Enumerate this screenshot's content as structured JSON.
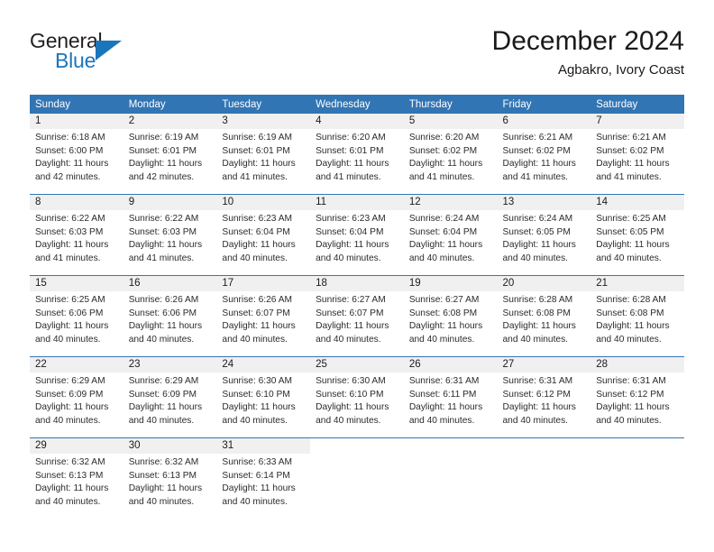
{
  "logo": {
    "word_one": "General",
    "word_two": "Blue",
    "triangle": "triangle-icon"
  },
  "header": {
    "title": "December 2024",
    "subtitle": "Agbakro, Ivory Coast"
  },
  "calendar": {
    "weekday_headers": [
      "Sunday",
      "Monday",
      "Tuesday",
      "Wednesday",
      "Thursday",
      "Friday",
      "Saturday"
    ],
    "accent_color": "#3275b4",
    "daynum_band_color": "#f0f0f0",
    "weeks": [
      [
        {
          "day": "1",
          "sunrise": "Sunrise: 6:18 AM",
          "sunset": "Sunset: 6:00 PM",
          "daylight_line1": "Daylight: 11 hours",
          "daylight_line2": "and 42 minutes."
        },
        {
          "day": "2",
          "sunrise": "Sunrise: 6:19 AM",
          "sunset": "Sunset: 6:01 PM",
          "daylight_line1": "Daylight: 11 hours",
          "daylight_line2": "and 42 minutes."
        },
        {
          "day": "3",
          "sunrise": "Sunrise: 6:19 AM",
          "sunset": "Sunset: 6:01 PM",
          "daylight_line1": "Daylight: 11 hours",
          "daylight_line2": "and 41 minutes."
        },
        {
          "day": "4",
          "sunrise": "Sunrise: 6:20 AM",
          "sunset": "Sunset: 6:01 PM",
          "daylight_line1": "Daylight: 11 hours",
          "daylight_line2": "and 41 minutes."
        },
        {
          "day": "5",
          "sunrise": "Sunrise: 6:20 AM",
          "sunset": "Sunset: 6:02 PM",
          "daylight_line1": "Daylight: 11 hours",
          "daylight_line2": "and 41 minutes."
        },
        {
          "day": "6",
          "sunrise": "Sunrise: 6:21 AM",
          "sunset": "Sunset: 6:02 PM",
          "daylight_line1": "Daylight: 11 hours",
          "daylight_line2": "and 41 minutes."
        },
        {
          "day": "7",
          "sunrise": "Sunrise: 6:21 AM",
          "sunset": "Sunset: 6:02 PM",
          "daylight_line1": "Daylight: 11 hours",
          "daylight_line2": "and 41 minutes."
        }
      ],
      [
        {
          "day": "8",
          "sunrise": "Sunrise: 6:22 AM",
          "sunset": "Sunset: 6:03 PM",
          "daylight_line1": "Daylight: 11 hours",
          "daylight_line2": "and 41 minutes."
        },
        {
          "day": "9",
          "sunrise": "Sunrise: 6:22 AM",
          "sunset": "Sunset: 6:03 PM",
          "daylight_line1": "Daylight: 11 hours",
          "daylight_line2": "and 41 minutes."
        },
        {
          "day": "10",
          "sunrise": "Sunrise: 6:23 AM",
          "sunset": "Sunset: 6:04 PM",
          "daylight_line1": "Daylight: 11 hours",
          "daylight_line2": "and 40 minutes."
        },
        {
          "day": "11",
          "sunrise": "Sunrise: 6:23 AM",
          "sunset": "Sunset: 6:04 PM",
          "daylight_line1": "Daylight: 11 hours",
          "daylight_line2": "and 40 minutes."
        },
        {
          "day": "12",
          "sunrise": "Sunrise: 6:24 AM",
          "sunset": "Sunset: 6:04 PM",
          "daylight_line1": "Daylight: 11 hours",
          "daylight_line2": "and 40 minutes."
        },
        {
          "day": "13",
          "sunrise": "Sunrise: 6:24 AM",
          "sunset": "Sunset: 6:05 PM",
          "daylight_line1": "Daylight: 11 hours",
          "daylight_line2": "and 40 minutes."
        },
        {
          "day": "14",
          "sunrise": "Sunrise: 6:25 AM",
          "sunset": "Sunset: 6:05 PM",
          "daylight_line1": "Daylight: 11 hours",
          "daylight_line2": "and 40 minutes."
        }
      ],
      [
        {
          "day": "15",
          "sunrise": "Sunrise: 6:25 AM",
          "sunset": "Sunset: 6:06 PM",
          "daylight_line1": "Daylight: 11 hours",
          "daylight_line2": "and 40 minutes."
        },
        {
          "day": "16",
          "sunrise": "Sunrise: 6:26 AM",
          "sunset": "Sunset: 6:06 PM",
          "daylight_line1": "Daylight: 11 hours",
          "daylight_line2": "and 40 minutes."
        },
        {
          "day": "17",
          "sunrise": "Sunrise: 6:26 AM",
          "sunset": "Sunset: 6:07 PM",
          "daylight_line1": "Daylight: 11 hours",
          "daylight_line2": "and 40 minutes."
        },
        {
          "day": "18",
          "sunrise": "Sunrise: 6:27 AM",
          "sunset": "Sunset: 6:07 PM",
          "daylight_line1": "Daylight: 11 hours",
          "daylight_line2": "and 40 minutes."
        },
        {
          "day": "19",
          "sunrise": "Sunrise: 6:27 AM",
          "sunset": "Sunset: 6:08 PM",
          "daylight_line1": "Daylight: 11 hours",
          "daylight_line2": "and 40 minutes."
        },
        {
          "day": "20",
          "sunrise": "Sunrise: 6:28 AM",
          "sunset": "Sunset: 6:08 PM",
          "daylight_line1": "Daylight: 11 hours",
          "daylight_line2": "and 40 minutes."
        },
        {
          "day": "21",
          "sunrise": "Sunrise: 6:28 AM",
          "sunset": "Sunset: 6:08 PM",
          "daylight_line1": "Daylight: 11 hours",
          "daylight_line2": "and 40 minutes."
        }
      ],
      [
        {
          "day": "22",
          "sunrise": "Sunrise: 6:29 AM",
          "sunset": "Sunset: 6:09 PM",
          "daylight_line1": "Daylight: 11 hours",
          "daylight_line2": "and 40 minutes."
        },
        {
          "day": "23",
          "sunrise": "Sunrise: 6:29 AM",
          "sunset": "Sunset: 6:09 PM",
          "daylight_line1": "Daylight: 11 hours",
          "daylight_line2": "and 40 minutes."
        },
        {
          "day": "24",
          "sunrise": "Sunrise: 6:30 AM",
          "sunset": "Sunset: 6:10 PM",
          "daylight_line1": "Daylight: 11 hours",
          "daylight_line2": "and 40 minutes."
        },
        {
          "day": "25",
          "sunrise": "Sunrise: 6:30 AM",
          "sunset": "Sunset: 6:10 PM",
          "daylight_line1": "Daylight: 11 hours",
          "daylight_line2": "and 40 minutes."
        },
        {
          "day": "26",
          "sunrise": "Sunrise: 6:31 AM",
          "sunset": "Sunset: 6:11 PM",
          "daylight_line1": "Daylight: 11 hours",
          "daylight_line2": "and 40 minutes."
        },
        {
          "day": "27",
          "sunrise": "Sunrise: 6:31 AM",
          "sunset": "Sunset: 6:12 PM",
          "daylight_line1": "Daylight: 11 hours",
          "daylight_line2": "and 40 minutes."
        },
        {
          "day": "28",
          "sunrise": "Sunrise: 6:31 AM",
          "sunset": "Sunset: 6:12 PM",
          "daylight_line1": "Daylight: 11 hours",
          "daylight_line2": "and 40 minutes."
        }
      ],
      [
        {
          "day": "29",
          "sunrise": "Sunrise: 6:32 AM",
          "sunset": "Sunset: 6:13 PM",
          "daylight_line1": "Daylight: 11 hours",
          "daylight_line2": "and 40 minutes."
        },
        {
          "day": "30",
          "sunrise": "Sunrise: 6:32 AM",
          "sunset": "Sunset: 6:13 PM",
          "daylight_line1": "Daylight: 11 hours",
          "daylight_line2": "and 40 minutes."
        },
        {
          "day": "31",
          "sunrise": "Sunrise: 6:33 AM",
          "sunset": "Sunset: 6:14 PM",
          "daylight_line1": "Daylight: 11 hours",
          "daylight_line2": "and 40 minutes."
        },
        {
          "day": "",
          "sunrise": "",
          "sunset": "",
          "daylight_line1": "",
          "daylight_line2": ""
        },
        {
          "day": "",
          "sunrise": "",
          "sunset": "",
          "daylight_line1": "",
          "daylight_line2": ""
        },
        {
          "day": "",
          "sunrise": "",
          "sunset": "",
          "daylight_line1": "",
          "daylight_line2": ""
        },
        {
          "day": "",
          "sunrise": "",
          "sunset": "",
          "daylight_line1": "",
          "daylight_line2": ""
        }
      ]
    ]
  }
}
